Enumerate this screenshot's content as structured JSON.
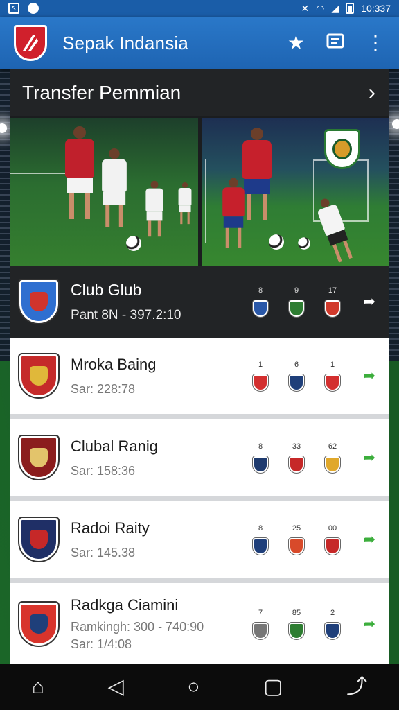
{
  "status_bar": {
    "time": "10:337",
    "left_icons": [
      "image-icon",
      "target-icon"
    ],
    "right_icons": [
      "silent-icon",
      "wifi-icon",
      "signal-icon",
      "battery-icon"
    ]
  },
  "app_bar": {
    "title": "Sepak Indansia",
    "actions": [
      "star-icon",
      "feedback-icon",
      "more-vert-icon"
    ]
  },
  "section": {
    "title": "Transfer Pemmian"
  },
  "clubs": [
    {
      "name": "Club Glub",
      "subtitle": "Pant 8N - 397.2:10",
      "crest_color": "#2f6fd0",
      "crest_inner": "#d0342c",
      "badges": [
        {
          "num": "8",
          "color": "#2a58a8"
        },
        {
          "num": "9",
          "color": "#2e7d32"
        },
        {
          "num": "17",
          "color": "#d13a2c"
        }
      ],
      "highlighted": true
    },
    {
      "name": "Mroka Baing",
      "subtitle": "Sar: 228:78",
      "crest_color": "#c52a2a",
      "crest_inner": "#e0b83a",
      "badges": [
        {
          "num": "1",
          "color": "#d32f2f"
        },
        {
          "num": "6",
          "color": "#1f3f7a"
        },
        {
          "num": "1",
          "color": "#d32f2f"
        }
      ],
      "highlighted": false
    },
    {
      "name": "Clubal Ranig",
      "subtitle": "Sar: 158:36",
      "crest_color": "#8b1d1d",
      "crest_inner": "#e3c46b",
      "badges": [
        {
          "num": "8",
          "color": "#1e3a6e"
        },
        {
          "num": "33",
          "color": "#c62828"
        },
        {
          "num": "62",
          "color": "#e0a82b"
        }
      ],
      "highlighted": false
    },
    {
      "name": "Radoi Raity",
      "subtitle": "Sar: 145.38",
      "crest_color": "#1f2f66",
      "crest_inner": "#c62828",
      "badges": [
        {
          "num": "8",
          "color": "#1f3f7a"
        },
        {
          "num": "25",
          "color": "#d84a2a"
        },
        {
          "num": "00",
          "color": "#c62828"
        }
      ],
      "highlighted": false
    },
    {
      "name": "Radkga Ciamini",
      "subtitle": "Ramkingh: 300 - 740:90",
      "extra": "Sar: 1/4:08",
      "crest_color": "#d8342c",
      "crest_inner": "#1f3f7a",
      "badges": [
        {
          "num": "7",
          "color": "#777777"
        },
        {
          "num": "85",
          "color": "#2e7d32"
        },
        {
          "num": "2",
          "color": "#1f3f7a"
        }
      ],
      "highlighted": false
    }
  ],
  "nav_bar": {
    "items": [
      "home-icon",
      "back-icon",
      "home-circle-icon",
      "recents-icon",
      "gesture-icon"
    ]
  },
  "colors": {
    "app_bar": "#1e64b2",
    "accent_green": "#3cae3c",
    "dark_row": "#222426"
  }
}
